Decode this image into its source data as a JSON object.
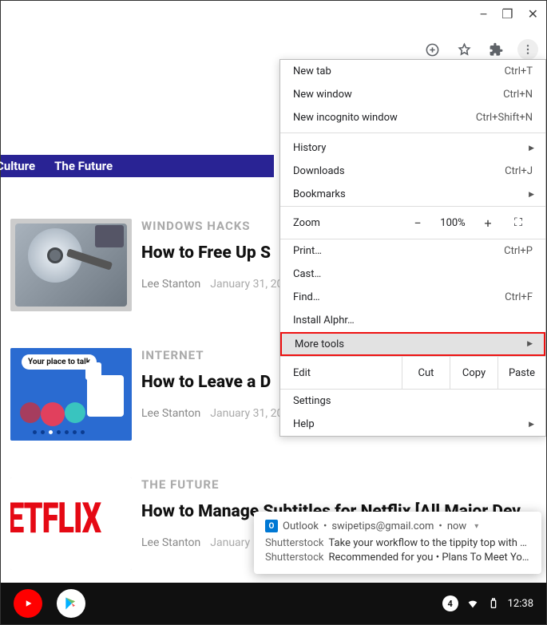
{
  "window_controls": {
    "minimize": "−",
    "restore": "❐",
    "close": "✕"
  },
  "toolbar_icons": {
    "add": "add-to-icon",
    "star": "bookmark-star-icon",
    "ext": "extensions-puzzle-icon",
    "menu": "kebab-menu-icon"
  },
  "nav": {
    "item1": "Culture",
    "item2": "The Future"
  },
  "articles": [
    {
      "cat": "WINDOWS HACKS",
      "title": "How to Free Up S",
      "author": "Lee Stanton",
      "date": "January 31, 20"
    },
    {
      "cat": "INTERNET",
      "title": "How to Leave a D",
      "author": "Lee Stanton",
      "date": "January 31, 20",
      "thumb_caption": "Your place to talk"
    },
    {
      "cat": "THE FUTURE",
      "title": "How to Manage Subtitles for Netflix [All Major Dev",
      "author": "Lee Stanton",
      "date": "January",
      "thumb_text": "ETFLIX"
    }
  ],
  "menu": {
    "new_tab": "New tab",
    "new_tab_sc": "Ctrl+T",
    "new_window": "New window",
    "new_window_sc": "Ctrl+N",
    "incognito": "New incognito window",
    "incognito_sc": "Ctrl+Shift+N",
    "history": "History",
    "downloads": "Downloads",
    "downloads_sc": "Ctrl+J",
    "bookmarks": "Bookmarks",
    "zoom_label": "Zoom",
    "zoom_minus": "−",
    "zoom_pct": "100%",
    "zoom_plus": "+",
    "full": "⛶",
    "print": "Print…",
    "print_sc": "Ctrl+P",
    "cast": "Cast…",
    "find": "Find…",
    "find_sc": "Ctrl+F",
    "install": "Install Alphr…",
    "more_tools": "More tools",
    "edit_label": "Edit",
    "cut": "Cut",
    "copy": "Copy",
    "paste": "Paste",
    "settings": "Settings",
    "help": "Help"
  },
  "notification": {
    "head_app": "Outlook",
    "head_email": "swipetips@gmail.com",
    "head_time": "now",
    "line1_src": "Shutterstock",
    "line1_txt": "Take your workflow to the tippity top with C…",
    "line2_src": "Shutterstock",
    "line2_txt": "Recommended for you • Plans To Meet Yo…"
  },
  "taskbar": {
    "count": "4",
    "time": "12:38"
  }
}
